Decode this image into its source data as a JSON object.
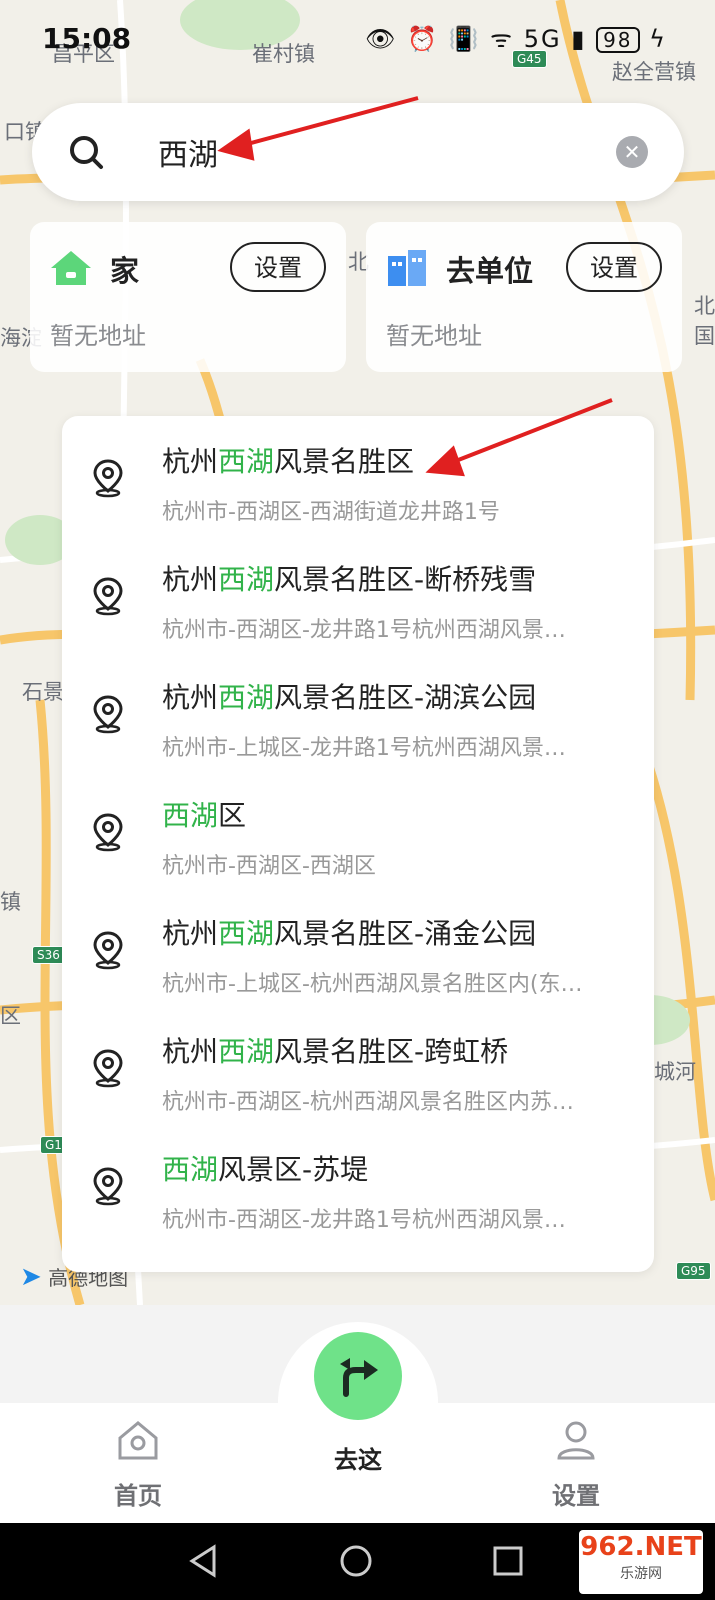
{
  "status_bar": {
    "time": "15:08",
    "battery": "98",
    "icons": "👁 ⏰ 📳 ᯤ 5G ▮"
  },
  "map": {
    "labels": [
      "昌平区",
      "崔村镇",
      "赵全营镇",
      "口镇",
      "海淀",
      "北",
      "北国",
      "石景",
      "镇",
      "区",
      "城河"
    ],
    "shields": [
      "G45",
      "S36",
      "G1",
      "G95"
    ],
    "provider": "高德地图"
  },
  "search": {
    "query": "西湖"
  },
  "quick_cards": {
    "home": {
      "title": "家",
      "set_label": "设置",
      "subtitle": "暂无地址"
    },
    "work": {
      "title": "去单位",
      "set_label": "设置",
      "subtitle": "暂无地址"
    }
  },
  "results": [
    {
      "pre": "杭州",
      "hl": "西湖",
      "post": "风景名胜区",
      "address": "杭州市-西湖区-西湖街道龙井路1号"
    },
    {
      "pre": "杭州",
      "hl": "西湖",
      "post": "风景名胜区-断桥残雪",
      "address": "杭州市-西湖区-龙井路1号杭州西湖风景…"
    },
    {
      "pre": "杭州",
      "hl": "西湖",
      "post": "风景名胜区-湖滨公园",
      "address": "杭州市-上城区-龙井路1号杭州西湖风景…"
    },
    {
      "pre": "",
      "hl": "西湖",
      "post": "区",
      "address": "杭州市-西湖区-西湖区"
    },
    {
      "pre": "杭州",
      "hl": "西湖",
      "post": "风景名胜区-涌金公园",
      "address": "杭州市-上城区-杭州西湖风景名胜区内(东…"
    },
    {
      "pre": "杭州",
      "hl": "西湖",
      "post": "风景名胜区-跨虹桥",
      "address": "杭州市-西湖区-杭州西湖风景名胜区内苏…"
    },
    {
      "pre": "",
      "hl": "西湖",
      "post": "风景区-苏堤",
      "address": "杭州市-西湖区-龙井路1号杭州西湖风景…"
    }
  ],
  "tabs": {
    "home": "首页",
    "go": "去这",
    "settings": "设置"
  },
  "watermark": {
    "logo": "962.NET",
    "sub": "乐游网"
  },
  "colors": {
    "highlight": "#31b34a",
    "fab": "#6fe289",
    "arrow": "#e02020"
  }
}
